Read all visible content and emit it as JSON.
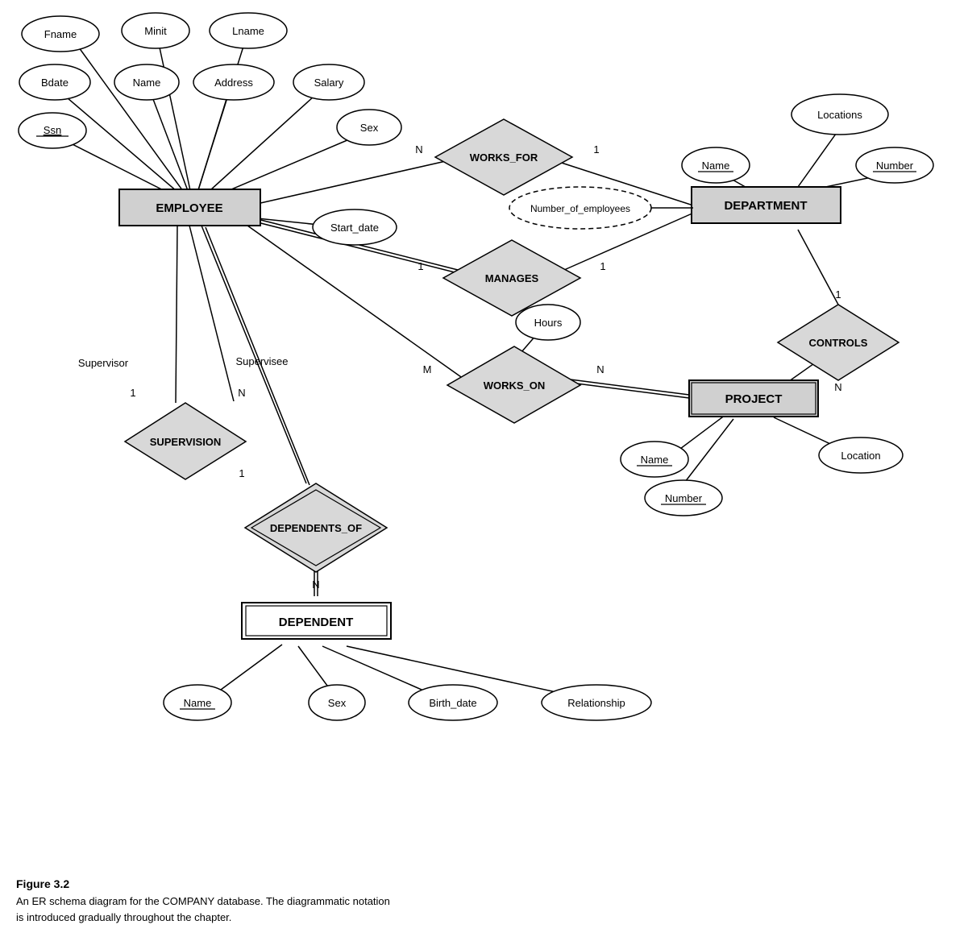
{
  "caption": {
    "title": "Figure 3.2",
    "line1": "An ER schema diagram for the COMPANY database. The diagrammatic notation",
    "line2": "is introduced gradually throughout the chapter."
  },
  "entities": {
    "employee": "EMPLOYEE",
    "department": "DEPARTMENT",
    "project": "PROJECT",
    "dependent": "DEPENDENT"
  },
  "relationships": {
    "works_for": "WORKS_FOR",
    "manages": "MANAGES",
    "works_on": "WORKS_ON",
    "controls": "CONTROLS",
    "supervision": "SUPERVISION",
    "dependents_of": "DEPENDENTS_OF"
  }
}
